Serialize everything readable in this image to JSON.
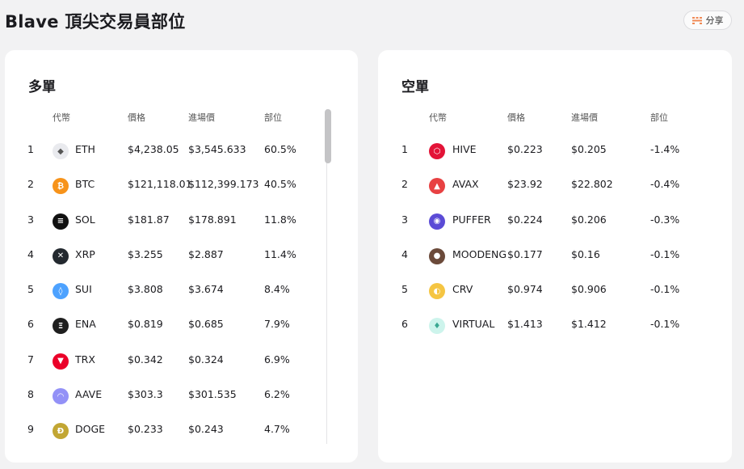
{
  "header": {
    "title": "Blave 頂尖交易員部位",
    "share_label": "分享"
  },
  "long": {
    "title": "多單",
    "columns": {
      "coin": "代幣",
      "price": "價格",
      "entry": "進場價",
      "position": "部位"
    },
    "rows": [
      {
        "rank": "1",
        "symbol": "ETH",
        "price": "$4,238.05",
        "entry": "$3,545.633",
        "position": "60.5%",
        "icon": "eth-icon",
        "color": "#e9eaee"
      },
      {
        "rank": "2",
        "symbol": "BTC",
        "price": "$121,118.01",
        "entry": "$112,399.173",
        "position": "40.5%",
        "icon": "btc-icon",
        "color": "#f7931a"
      },
      {
        "rank": "3",
        "symbol": "SOL",
        "price": "$181.87",
        "entry": "$178.891",
        "position": "11.8%",
        "icon": "sol-icon",
        "color": "#111111"
      },
      {
        "rank": "4",
        "symbol": "XRP",
        "price": "$3.255",
        "entry": "$2.887",
        "position": "11.4%",
        "icon": "xrp-icon",
        "color": "#23292f"
      },
      {
        "rank": "5",
        "symbol": "SUI",
        "price": "$3.808",
        "entry": "$3.674",
        "position": "8.4%",
        "icon": "sui-icon",
        "color": "#4da2ff"
      },
      {
        "rank": "6",
        "symbol": "ENA",
        "price": "$0.819",
        "entry": "$0.685",
        "position": "7.9%",
        "icon": "ena-icon",
        "color": "#1f1f1f"
      },
      {
        "rank": "7",
        "symbol": "TRX",
        "price": "$0.342",
        "entry": "$0.324",
        "position": "6.9%",
        "icon": "trx-icon",
        "color": "#eb0029"
      },
      {
        "rank": "8",
        "symbol": "AAVE",
        "price": "$303.3",
        "entry": "$301.535",
        "position": "6.2%",
        "icon": "aave-icon",
        "color": "#9391f7"
      },
      {
        "rank": "9",
        "symbol": "DOGE",
        "price": "$0.233",
        "entry": "$0.243",
        "position": "4.7%",
        "icon": "doge-icon",
        "color": "#c2a633"
      }
    ]
  },
  "short": {
    "title": "空單",
    "columns": {
      "coin": "代幣",
      "price": "價格",
      "entry": "進場價",
      "position": "部位"
    },
    "rows": [
      {
        "rank": "1",
        "symbol": "HIVE",
        "price": "$0.223",
        "entry": "$0.205",
        "position": "-1.4%",
        "icon": "hive-icon",
        "color": "#e31337"
      },
      {
        "rank": "2",
        "symbol": "AVAX",
        "price": "$23.92",
        "entry": "$22.802",
        "position": "-0.4%",
        "icon": "avax-icon",
        "color": "#e84142"
      },
      {
        "rank": "3",
        "symbol": "PUFFER",
        "price": "$0.224",
        "entry": "$0.206",
        "position": "-0.3%",
        "icon": "puffer-icon",
        "color": "#5b4bd6"
      },
      {
        "rank": "4",
        "symbol": "MOODENG",
        "price": "$0.177",
        "entry": "$0.16",
        "position": "-0.1%",
        "icon": "moodeng-icon",
        "color": "#6b4a3a"
      },
      {
        "rank": "5",
        "symbol": "CRV",
        "price": "$0.974",
        "entry": "$0.906",
        "position": "-0.1%",
        "icon": "crv-icon",
        "color": "#f5c542"
      },
      {
        "rank": "6",
        "symbol": "VIRTUAL",
        "price": "$1.413",
        "entry": "$1.412",
        "position": "-0.1%",
        "icon": "virtual-icon",
        "color": "#cdf4ec"
      }
    ]
  }
}
